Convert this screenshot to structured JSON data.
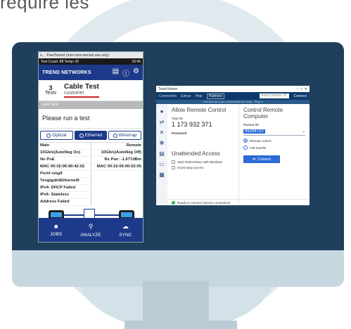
{
  "heading": "require les",
  "phone": {
    "tab1": "s...",
    "tab2": "FreeTorrent (mor-com-mercial use only)",
    "status_left": "Test Count: 88 Temp: 42",
    "status_right": "15:46",
    "brand": "TREND NETWORKS",
    "count": "3",
    "count_label": "Tests",
    "test_title": "Cable Test",
    "test_sub": "customer",
    "last_test": "Last Test",
    "prompt": "Please run a test",
    "modes": [
      "Optical",
      "Ethernet",
      "Wiremap"
    ],
    "active_mode": "Ethernet",
    "table": {
      "main_header": "Main",
      "remote_header": "Remote",
      "main": [
        "10Gb/s(AutoNeg On)",
        "No PoE",
        "MAC 00:16:06:90:42:02",
        "Port# xmg9",
        "TengigabitEthernet9",
        "IPv4- DHCP Failed",
        "IPv6- Stateless",
        "Address Failed"
      ],
      "remote": [
        "10Gb/s(AutoNeg Off)",
        "Rx Pwr: -1.677dBm",
        "MAC 00:16:06:90:02:05"
      ]
    },
    "nav": [
      "JOBS",
      "ANALYZE",
      "SYNC"
    ]
  },
  "teamviewer": {
    "title": "TeamViewer",
    "menu": [
      "Connection",
      "Extras",
      "Help"
    ],
    "partners": "Partners",
    "insert_placeholder": "Insert partner ID",
    "connect_top": "Connect",
    "banner": "Free license (non-commercial use only) - Reg to",
    "allow_title": "Allow Remote Control",
    "your_id_label": "Your ID",
    "your_id": "1 173 932 371",
    "password_label": "Password",
    "unattended_title": "Unattended Access",
    "start_with_windows": "Start TeamViewer with Windows",
    "grant_easy_access": "Grant easy access",
    "control_title": "Control Remote Computer",
    "partner_id_label": "Partner ID",
    "partner_id": "45294722",
    "remote_control": "Remote control",
    "file_transfer": "File transfer",
    "connect_btn": "Connect",
    "status": "Ready to connect (secure connection)"
  },
  "colors": {
    "screen_bg": "#1f3f5c",
    "trend_blue": "#1d3a8a",
    "tv_blue": "#2c6bd6",
    "ring": "#c9d9e2"
  }
}
